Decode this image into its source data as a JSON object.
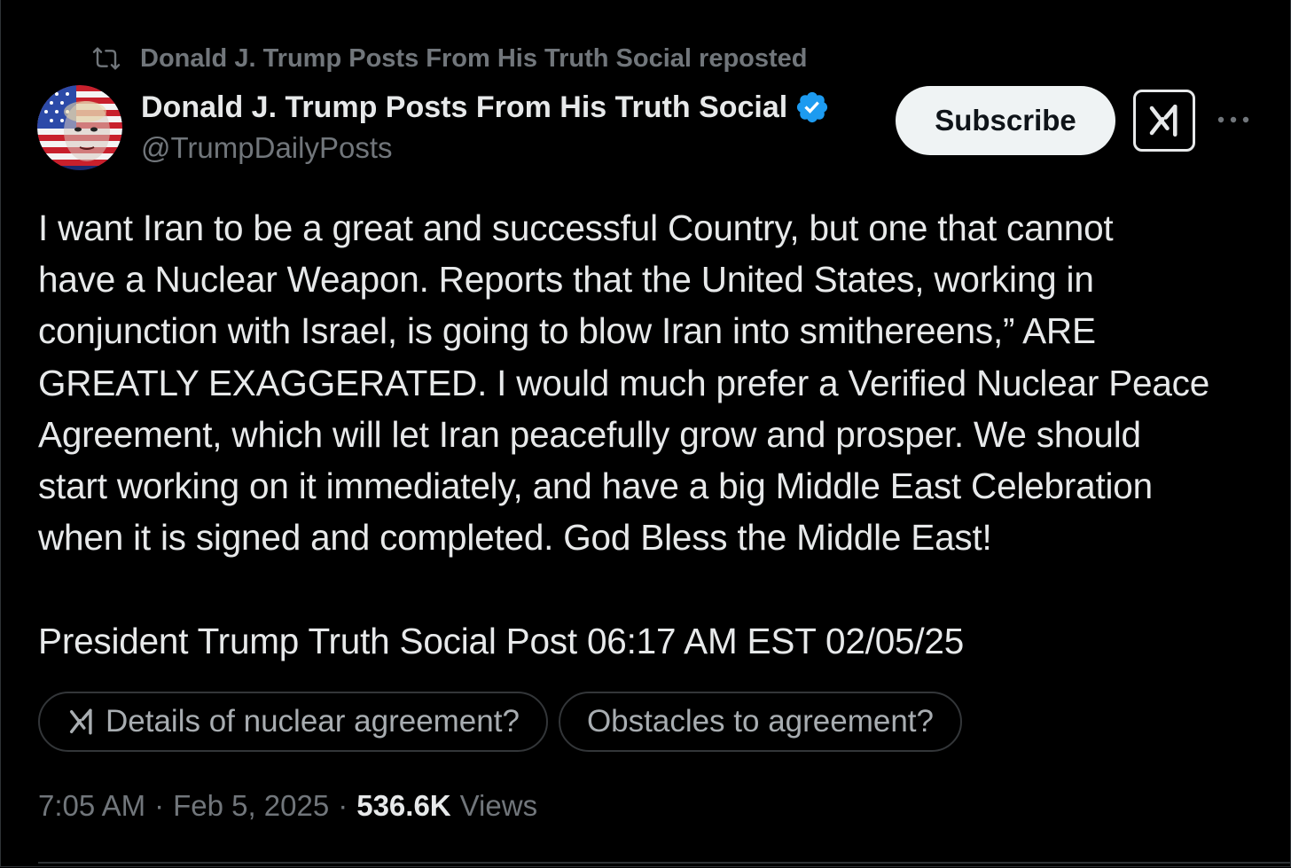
{
  "repost": {
    "text": "Donald J. Trump Posts From His Truth Social reposted",
    "icon": "repost-icon"
  },
  "author": {
    "name": "Donald J. Trump Posts From His Truth Social",
    "handle": "@TrumpDailyPosts",
    "verified": true,
    "avatar_icon": "flag-portrait-avatar"
  },
  "actions": {
    "subscribe_label": "Subscribe",
    "grok_icon": "grok-icon",
    "more_icon": "more-icon"
  },
  "post": {
    "body": "I want Iran to be a great and successful Country, but one that cannot\nhave a Nuclear Weapon. Reports that the United States, working in\nconjunction with Israel, is going to blow Iran into smithereens,” ARE\nGREATLY EXAGGERATED. I would much prefer a Verified Nuclear Peace\nAgreement, which will let Iran peacefully grow and prosper. We should\nstart working on it immediately, and have a big Middle East Celebration\nwhen it is signed and completed. God Bless the Middle East!",
    "signature": "President Trump Truth Social Post 06:17 AM EST 02/05/25"
  },
  "grok_suggestions": [
    {
      "label": "Details of nuclear agreement?",
      "icon": "grok-icon"
    },
    {
      "label": "Obstacles to agreement?"
    }
  ],
  "meta": {
    "time": "7:05 AM",
    "separator": "·",
    "date": "Feb 5, 2025",
    "views_count": "536.6K",
    "views_label": "Views"
  },
  "colors": {
    "background": "#000000",
    "text": "#e7e9ea",
    "muted": "#71767b",
    "verified_blue": "#1d9bf0",
    "subscribe_bg": "#eff3f4"
  }
}
